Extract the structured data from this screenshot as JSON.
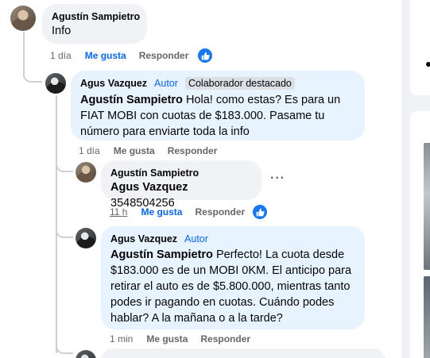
{
  "comments": [
    {
      "author": "Agustín Sampietro",
      "text": "Info",
      "time": "1 día",
      "like_label": "Me gusta",
      "reply_label": "Responder"
    },
    {
      "author": "Agus Vazquez",
      "author_tag": "Autor",
      "badge": "Colaborador destacado",
      "mention": "Agustín Sampietro",
      "text": "Hola! como estas? Es para un FIAT MOBI con cuotas de $183.000. Pasame tu número para enviarte toda la info",
      "time": "1 día",
      "like_label": "Me gusta",
      "reply_label": "Responder"
    },
    {
      "author": "Agustín Sampietro",
      "mention": "Agus Vazquez",
      "text": "3548504256",
      "time": "11 h",
      "like_label": "Me gusta",
      "reply_label": "Responder"
    },
    {
      "author": "Agus Vazquez",
      "author_tag": "Autor",
      "mention": "Agustín Sampietro",
      "text": "Perfecto! La cuota desde $183.000 es de un MOBI 0KM. El anticipo para retirar el auto es de $5.800.000, mientras tanto podes ir pagando en cuotas. Cuándo podes hablar? A la mañana o a la tarde?",
      "time": "1 min",
      "like_label": "Me gusta",
      "reply_label": "Responder"
    }
  ],
  "icons": {
    "more": "more-options-icon",
    "reaction": "like-reaction-icon"
  },
  "colors": {
    "accent": "#0866ff",
    "bubble_gray": "#f0f2f5",
    "bubble_blue": "#e7f3ff",
    "meta": "#65676b"
  }
}
